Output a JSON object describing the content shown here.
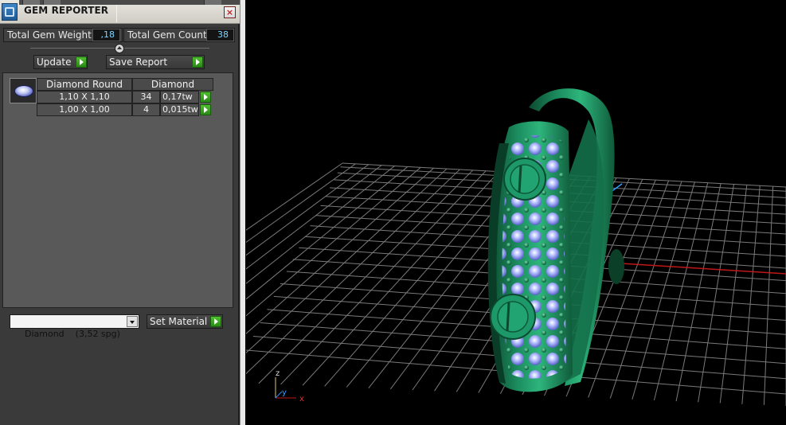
{
  "panel": {
    "title": "GEM REPORTER",
    "close_glyph": "×",
    "total_weight_label": "Total Gem Weight",
    "total_weight_value": ",18",
    "total_count_label": "Total Gem Count",
    "total_count_value": "38",
    "update_label": "Update",
    "save_report_label": "Save Report",
    "table": {
      "headers": [
        "Diamond Round",
        "Diamond"
      ],
      "rows": [
        {
          "size": "1,10 X 1,10",
          "count": "34",
          "weight": "0,17tw"
        },
        {
          "size": "1,00 X 1,00",
          "count": "4",
          "weight": "0,015tw"
        }
      ]
    },
    "material_select_value": "Diamond    (3,52 spg)",
    "set_material_label": "Set Material"
  },
  "viewport": {
    "axes": {
      "z": "z",
      "y": "y",
      "x": "x"
    }
  },
  "colors": {
    "panel_bg": "#3a3a3a",
    "value_text": "#7fd4ff",
    "go_button": "#3aa51f",
    "ring_metal": "#1a8a5e",
    "gem_blue": "#8f9ff0",
    "grid": "#7a7a7a",
    "x_axis": "#c01818",
    "y_axis": "#2aa0ff"
  },
  "icons": [
    "app-icon",
    "close-icon",
    "gem-thumbnail-icon",
    "go-arrow-icon",
    "dropdown-arrow-icon",
    "axis-triad-icon"
  ]
}
